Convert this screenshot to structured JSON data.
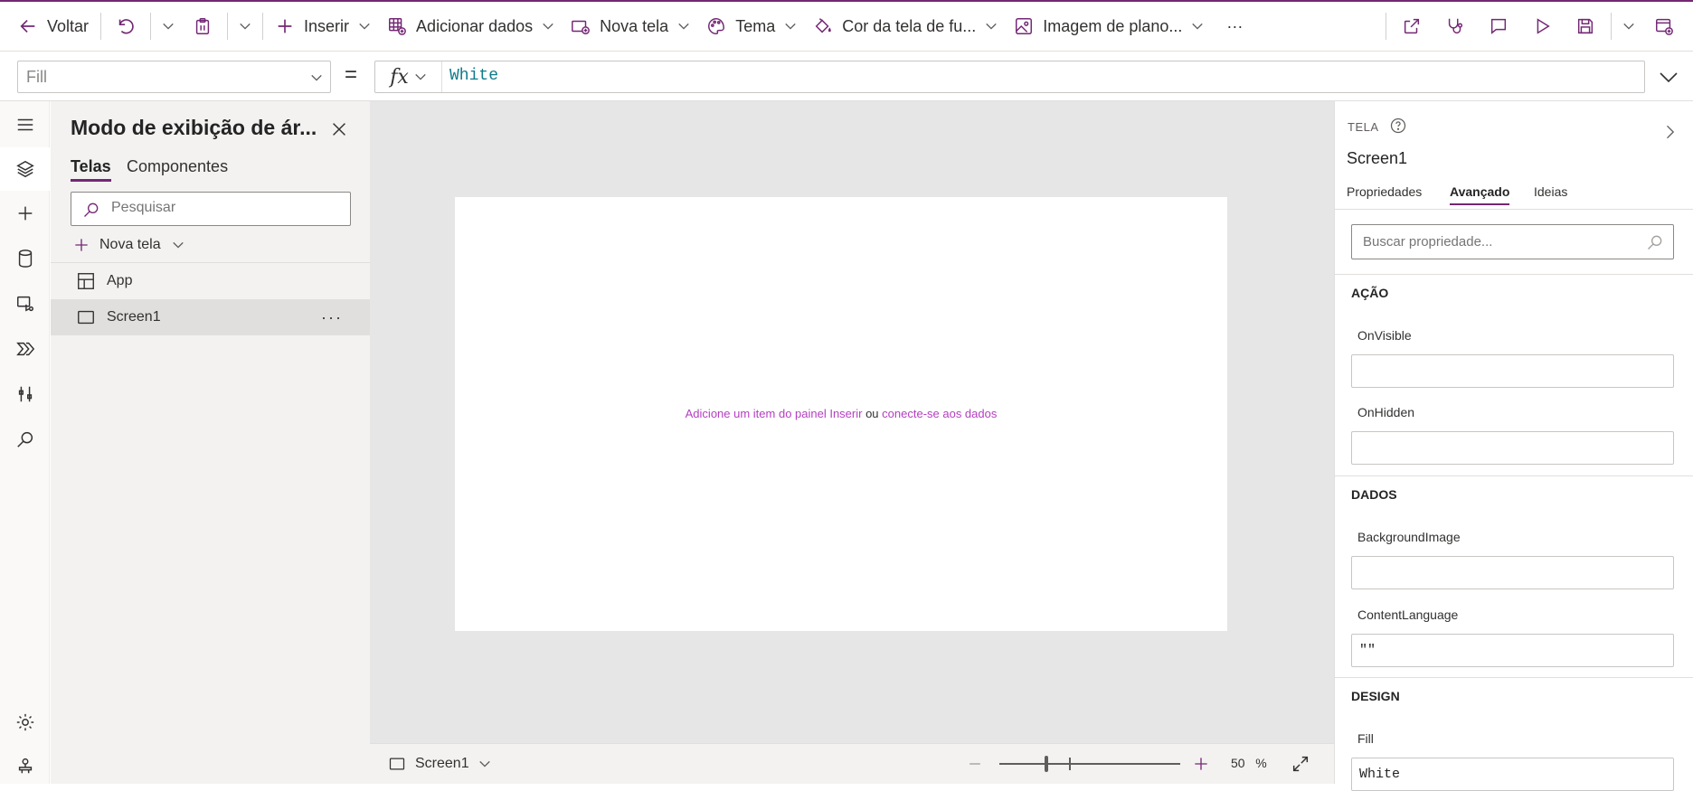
{
  "toolbar": {
    "back_label": "Voltar",
    "insert_label": "Inserir",
    "add_data_label": "Adicionar dados",
    "new_screen_label": "Nova tela",
    "theme_label": "Tema",
    "bg_color_label": "Cor da tela de fu...",
    "bg_image_label": "Imagem de plano...",
    "more_label": "···"
  },
  "formula": {
    "property": "Fill",
    "equals": "=",
    "fx": "fx",
    "value": "White"
  },
  "tree_panel": {
    "title": "Modo de exibição de ár...",
    "tabs": [
      "Telas",
      "Componentes"
    ],
    "search_placeholder": "Pesquisar",
    "new_screen_label": "Nova tela",
    "items": [
      {
        "label": "App"
      },
      {
        "label": "Screen1"
      }
    ],
    "more": "···"
  },
  "canvas": {
    "hint_part1": "Adicione um item do painel Inserir",
    "hint_or": " ou ",
    "hint_part2": "conecte-se aos dados"
  },
  "status_bar": {
    "screen_label": "Screen1",
    "zoom_value": "50",
    "zoom_unit": "%"
  },
  "properties_panel": {
    "kind": "TELA",
    "name": "Screen1",
    "tabs": [
      "Propriedades",
      "Avançado",
      "Ideias"
    ],
    "search_placeholder": "Buscar propriedade...",
    "sections": {
      "action": "AÇÃO",
      "data": "DADOS",
      "design": "DESIGN"
    },
    "props": [
      {
        "label": "OnVisible",
        "value": ""
      },
      {
        "label": "OnHidden",
        "value": ""
      },
      {
        "label": "BackgroundImage",
        "value": ""
      },
      {
        "label": "ContentLanguage",
        "value": "\"\""
      },
      {
        "label": "Fill",
        "value": "White"
      }
    ]
  },
  "colors": {
    "accent": "#742774",
    "link": "#b43ec0",
    "formula_value": "#0f7b8c",
    "canvas_bg": "#e6e6e6"
  }
}
